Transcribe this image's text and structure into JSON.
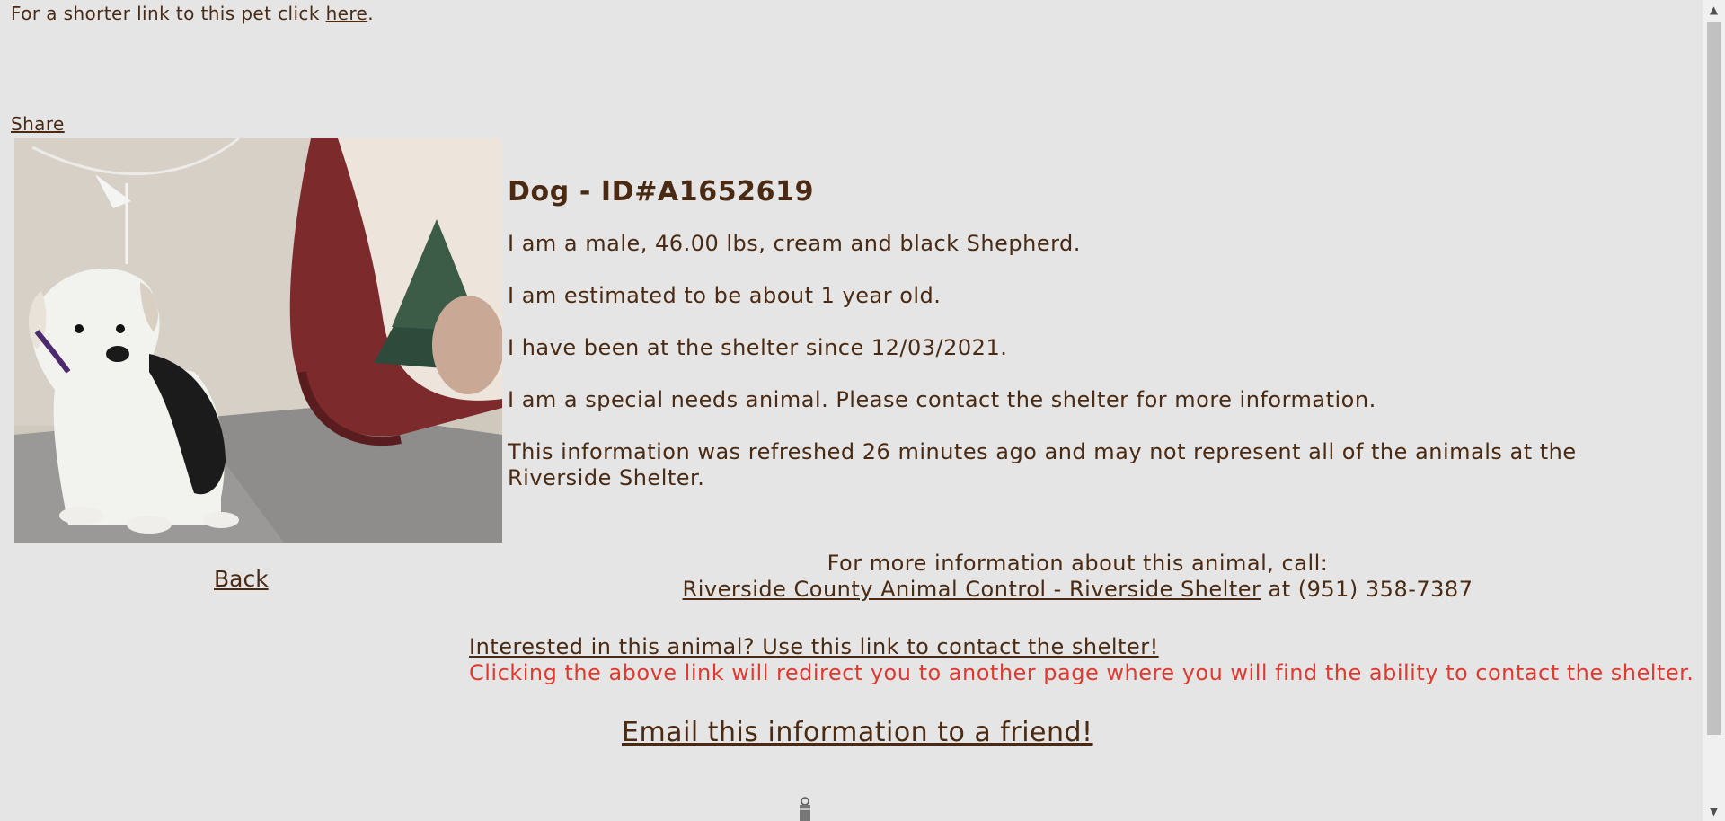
{
  "top": {
    "shorter_link_prefix": "For a shorter link to this pet click ",
    "shorter_link_label": "here",
    "shorter_link_suffix": "."
  },
  "share_label": "Share",
  "back_label": "Back",
  "animal": {
    "title": "Dog - ID#A1652619",
    "description": "I am a male, 46.00 lbs, cream and black Shepherd.",
    "age": "I am estimated to be about 1 year old.",
    "since": "I have been at the shelter since 12/03/2021.",
    "special_needs": "I am a special needs animal. Please contact the shelter for more information.",
    "refresh_note": "This information was refreshed 26 minutes ago and may not represent all of the animals at the Riverside Shelter."
  },
  "call": {
    "intro": "For more information about this animal, call:",
    "shelter_link": "Riverside County Animal Control - Riverside Shelter",
    "phone_text": " at (951) 358-7387"
  },
  "contact": {
    "link_label": "Interested in this animal? Use this link to contact the shelter!",
    "warning": "Clicking the above link will redirect you to another page where you will find the ability to contact the shelter."
  },
  "email_label": "Email this information to a friend!",
  "icons": {
    "scroll_up": "chevron-up-icon",
    "scroll_down": "chevron-down-icon",
    "loader": "loading-icon"
  },
  "colors": {
    "background": "#e5e5e5",
    "text": "#4a2a12",
    "warning": "#e03a30"
  }
}
